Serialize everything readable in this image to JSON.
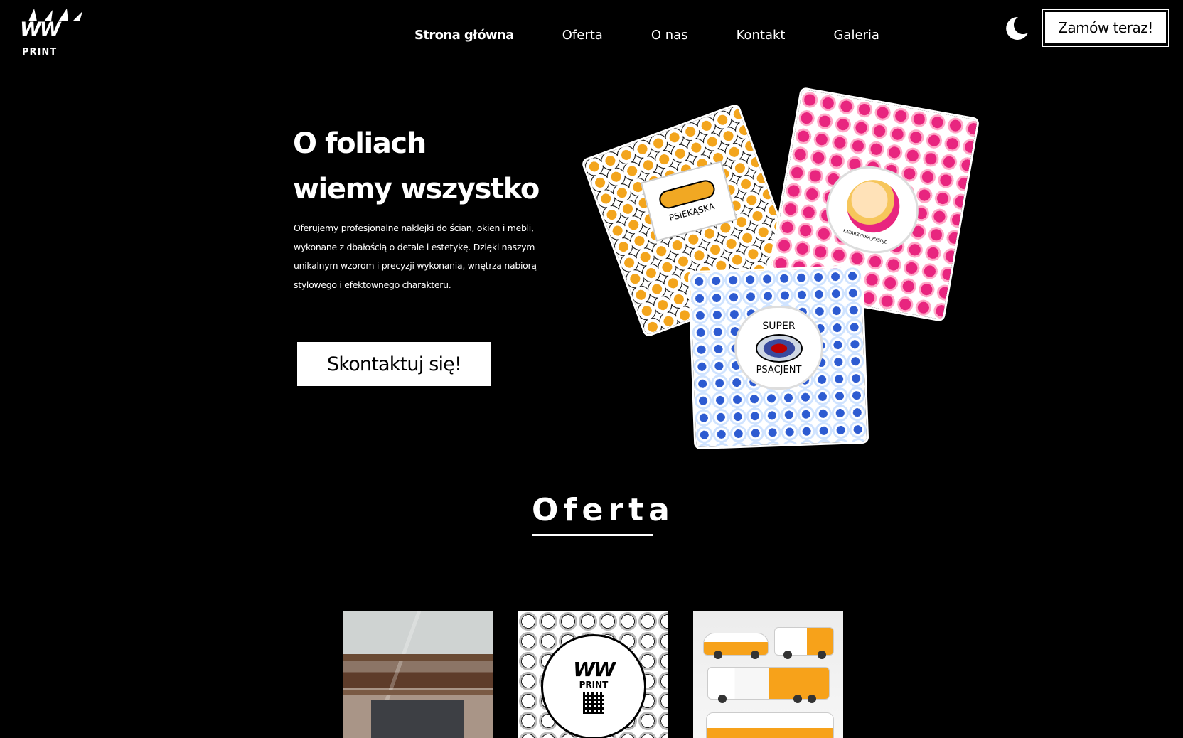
{
  "logo": {
    "main": "WW",
    "sub": "PRINT"
  },
  "nav": {
    "items": [
      {
        "label": "Strona główna",
        "active": true
      },
      {
        "label": "Oferta"
      },
      {
        "label": "O nas"
      },
      {
        "label": "Kontakt"
      },
      {
        "label": "Galeria"
      }
    ]
  },
  "header": {
    "theme_toggle_icon": "moon-icon",
    "cta_label": "Zamów teraz!"
  },
  "hero": {
    "title_line1": "O foliach",
    "title_line2": "wiemy wszystko",
    "description": "Oferujemy profesjonalne naklejki do ścian, okien i mebli, wykonane z dbałością o detale i estetykę. Dzięki naszym unikalnym wzorom i precyzji wykonania, wnętrza nabiorą stylowego i efektownego charakteru.",
    "button_label": "Skontaktuj się!",
    "collage": {
      "sticker_1_label": "PSIEKĄSKA",
      "sticker_2_label": "KATARZYNKA_RYSUJE",
      "sticker_3_top": "SUPER",
      "sticker_3_bottom": "PSACJENT"
    }
  },
  "offer": {
    "title": "Oferta",
    "cards": [
      {
        "name": "glass-foil"
      },
      {
        "name": "stickers",
        "logo_main": "WW",
        "logo_sub": "PRINT"
      },
      {
        "name": "vehicle-wraps"
      }
    ]
  },
  "colors": {
    "background": "#000000",
    "text": "#ffffff",
    "button_bg": "#ffffff",
    "button_text": "#000000"
  }
}
